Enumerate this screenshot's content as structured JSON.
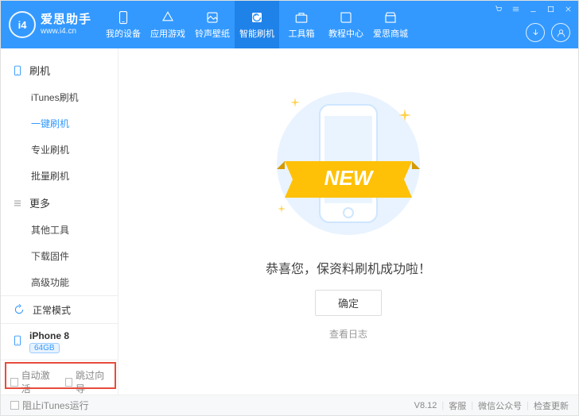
{
  "brand": {
    "name": "爱思助手",
    "url": "www.i4.cn",
    "logo_text": "i4"
  },
  "nav": [
    {
      "label": "我的设备"
    },
    {
      "label": "应用游戏"
    },
    {
      "label": "铃声壁纸"
    },
    {
      "label": "智能刷机"
    },
    {
      "label": "工具箱"
    },
    {
      "label": "教程中心"
    },
    {
      "label": "爱思商城"
    }
  ],
  "sidebar": {
    "section1": {
      "title": "刷机",
      "items": [
        "iTunes刷机",
        "一键刷机",
        "专业刷机",
        "批量刷机"
      ],
      "active_index": 1
    },
    "section2": {
      "title": "更多",
      "items": [
        "其他工具",
        "下载固件",
        "高级功能"
      ]
    },
    "mode": "正常模式",
    "device": {
      "name": "iPhone 8",
      "storage": "64GB"
    },
    "checkboxes": {
      "auto_activate": "自动激活",
      "skip_setup": "跳过向导"
    }
  },
  "main": {
    "banner": "NEW",
    "success": "恭喜您，保资料刷机成功啦！",
    "ok": "确定",
    "view_log": "查看日志"
  },
  "footer": {
    "prevent_itunes": "阻止iTunes运行",
    "version": "V8.12",
    "support": "客服",
    "wechat": "微信公众号",
    "update": "检查更新"
  }
}
